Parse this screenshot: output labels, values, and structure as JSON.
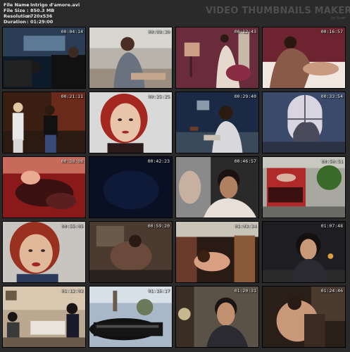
{
  "header": {
    "rows": [
      {
        "label": "File Name",
        "value": "Intrigo d'amore.avi"
      },
      {
        "label": "File Size",
        "value": "850.3 MB"
      },
      {
        "label": "Resolution",
        "value": "720x536"
      },
      {
        "label": "Duration",
        "value": "01:29:00"
      }
    ],
    "brand_title": "VIDEO THUMBNAILS MAKER",
    "brand_by": "by Scarr"
  },
  "thumbnails": [
    {
      "time": "00:04:14",
      "scene": "car-interior-night"
    },
    {
      "time": "00:08:30",
      "scene": "woman-outdoor-table"
    },
    {
      "time": "00:12:43",
      "scene": "photo-studio-couple"
    },
    {
      "time": "00:16:57",
      "scene": "couple-embrace-bed"
    },
    {
      "time": "00:21:11",
      "scene": "handshake-at-door"
    },
    {
      "time": "00:25:25",
      "scene": "redhead-closeup"
    },
    {
      "time": "00:29:40",
      "scene": "man-on-phone-desk"
    },
    {
      "time": "00:33:54",
      "scene": "silhouette-window"
    },
    {
      "time": "00:38:08",
      "scene": "red-tint-bodies"
    },
    {
      "time": "00:42:23",
      "scene": "dark-blue-frame"
    },
    {
      "time": "00:46:57",
      "scene": "couple-kiss-closeup"
    },
    {
      "time": "00:50:51",
      "scene": "red-storefront"
    },
    {
      "time": "00:55:05",
      "scene": "redhead-closeup-2"
    },
    {
      "time": "00:59:20",
      "scene": "dim-bedroom"
    },
    {
      "time": "01:03:34",
      "scene": "woman-lying-interior"
    },
    {
      "time": "01:07:48",
      "scene": "dark-hair-woman"
    },
    {
      "time": "01:12:03",
      "scene": "living-room-group"
    },
    {
      "time": "01:16:17",
      "scene": "black-car-driveway"
    },
    {
      "time": "01:20:31",
      "scene": "man-portrait-clock"
    },
    {
      "time": "01:24:46",
      "scene": "couple-night-embrace"
    }
  ]
}
